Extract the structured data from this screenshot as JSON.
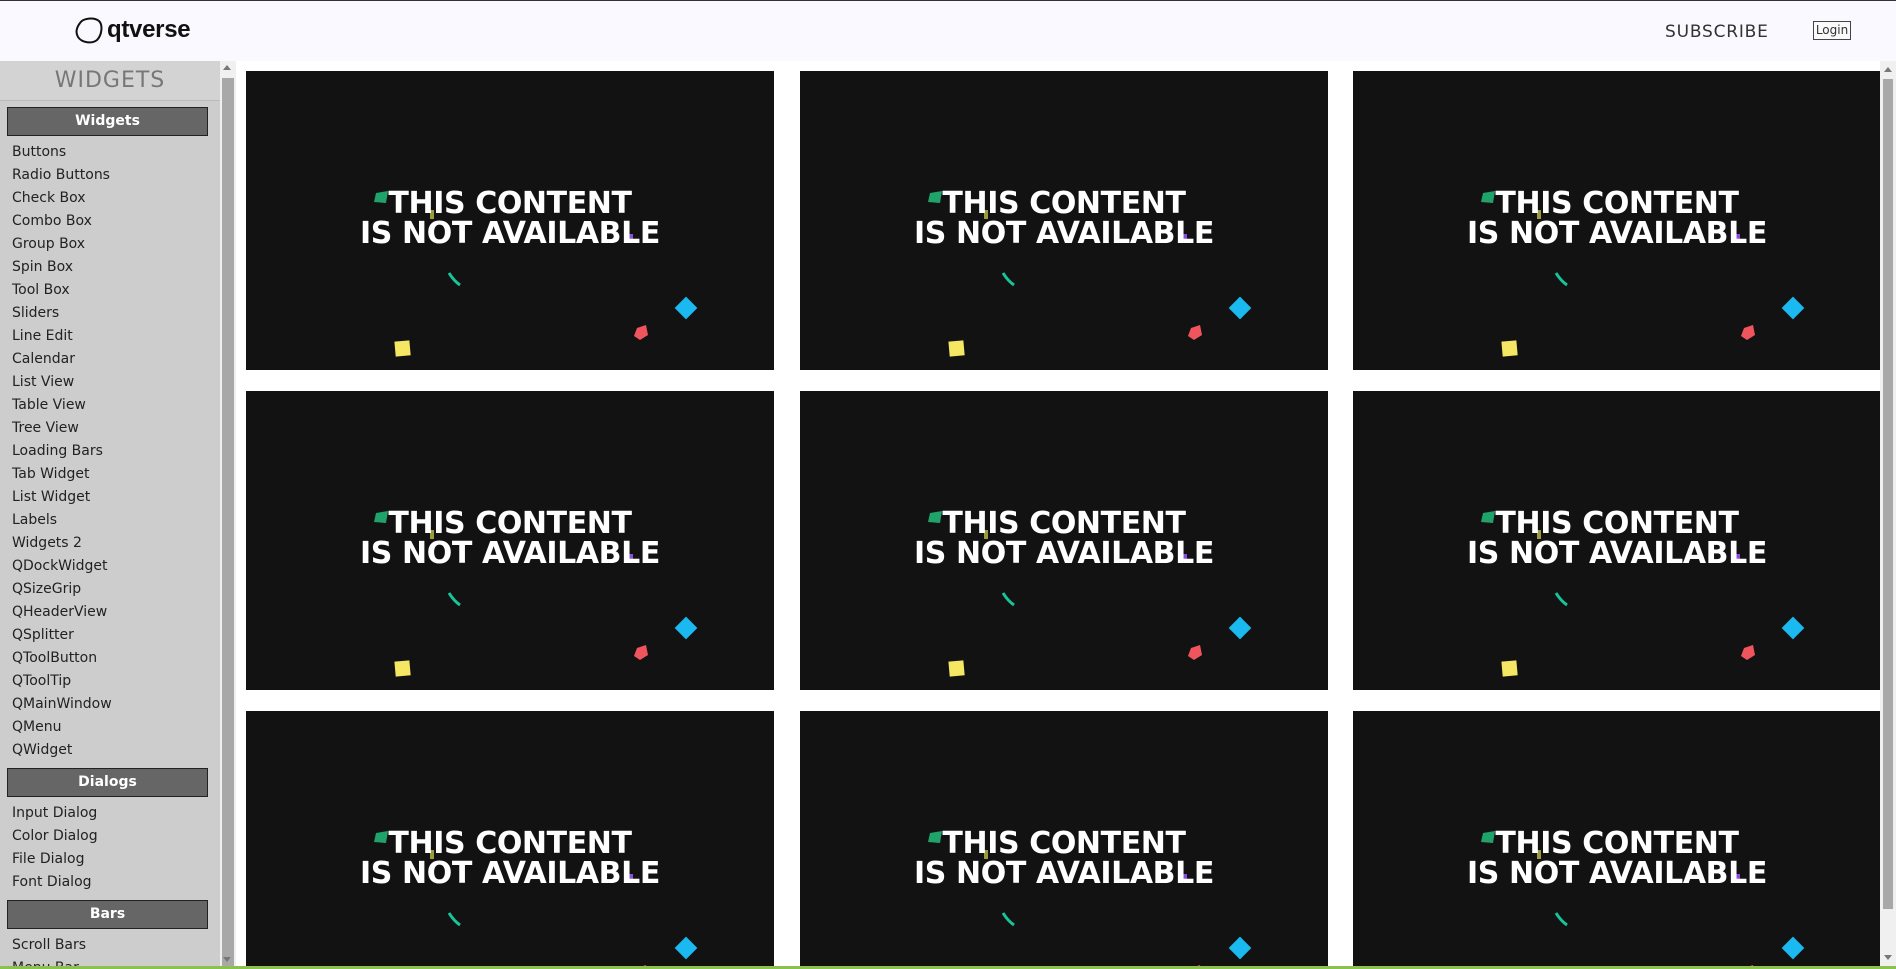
{
  "header": {
    "logo_text": "qtverse",
    "subscribe_label": "SUBSCRIBE",
    "login_label": "Login"
  },
  "sidebar": {
    "title": "WIDGETS",
    "sections": [
      {
        "label": "Widgets",
        "items": [
          "Buttons",
          "Radio Buttons",
          "Check Box",
          "Combo Box",
          "Group Box",
          "Spin Box",
          "Tool Box",
          "Sliders",
          "Line Edit",
          "Calendar",
          "List View",
          "Table View",
          "Tree View",
          "Loading Bars",
          "Tab Widget",
          "List Widget",
          "Labels",
          "Widgets 2",
          "QDockWidget",
          "QSizeGrip",
          "QHeaderView",
          "QSplitter",
          "QToolButton",
          "QToolTip",
          "QMainWindow",
          "QMenu",
          "QWidget"
        ]
      },
      {
        "label": "Dialogs",
        "items": [
          "Input Dialog",
          "Color Dialog",
          "File Dialog",
          "Font Dialog"
        ]
      },
      {
        "label": "Bars",
        "items": [
          "Scroll Bars",
          "Menu Bar"
        ]
      }
    ]
  },
  "tiles": {
    "line1": "THIS CONTENT",
    "line2": "IS NOT AVAILABLE",
    "count": 9,
    "colors": {
      "background": "#121212",
      "green": "#1fa36b",
      "teal": "#19c49a",
      "yellow": "#f5e663",
      "red": "#f0555e",
      "cyan": "#1ab9f0",
      "purple": "#8a4fd8",
      "olive": "#9b9a3c"
    }
  },
  "colors": {
    "sidebar_bg": "#cdcdcd",
    "section_bg": "#666666",
    "accent_bar": "#8bc34a"
  }
}
